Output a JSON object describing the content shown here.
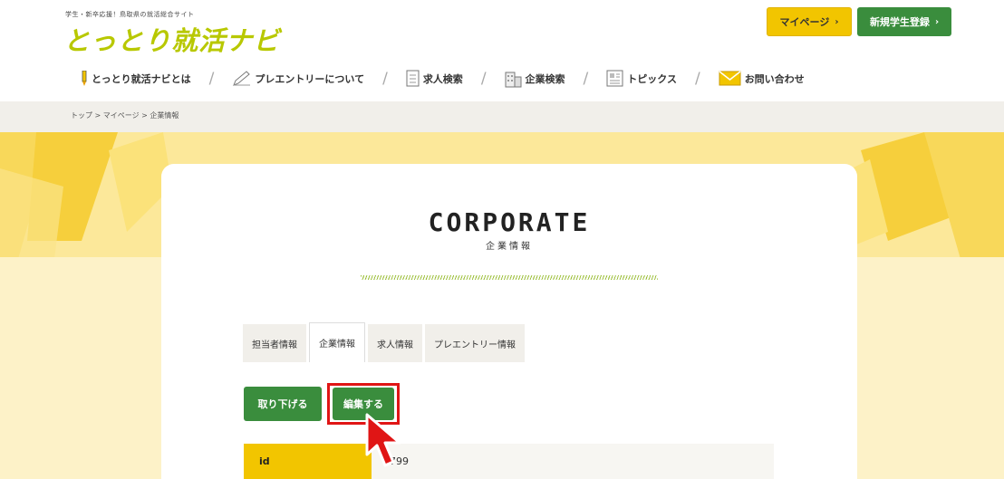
{
  "header": {
    "tagline": "学生・新卒応援！鳥取県の就活総合サイト",
    "logo": "とっとり就活ナビ",
    "mypage_label": "マイページ",
    "register_label": "新規学生登録",
    "chevron": "›"
  },
  "nav": {
    "items": [
      {
        "label": "とっとり就活ナビとは",
        "icon": "pencil-tip-icon"
      },
      {
        "label": "プレエントリーについて",
        "icon": "pen-icon"
      },
      {
        "label": "求人検索",
        "icon": "document-icon"
      },
      {
        "label": "企業検索",
        "icon": "building-icon"
      },
      {
        "label": "トピックス",
        "icon": "news-icon"
      },
      {
        "label": "お問い合わせ",
        "icon": "envelope-icon"
      }
    ],
    "separator": "/"
  },
  "breadcrumb": "トップ > マイページ > 企業情報",
  "card": {
    "title": "CORPORATE",
    "subtitle": "企業情報"
  },
  "tabs": [
    {
      "label": "担当者情報",
      "active": false
    },
    {
      "label": "企業情報",
      "active": true
    },
    {
      "label": "求人情報",
      "active": false
    },
    {
      "label": "プレエントリー情報",
      "active": false
    }
  ],
  "actions": {
    "withdraw_label": "取り下げる",
    "edit_label": "編集する"
  },
  "table": {
    "rows": [
      {
        "label": "id",
        "value": "799"
      }
    ]
  },
  "colors": {
    "accent_yellow": "#f2c500",
    "accent_green": "#3a8d3d",
    "highlight_red": "#e01515"
  }
}
